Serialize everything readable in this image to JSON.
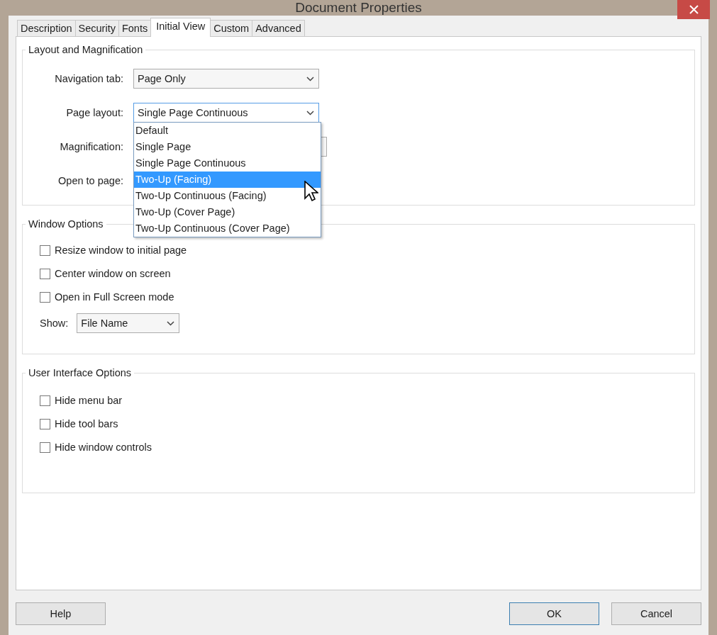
{
  "window": {
    "title": "Document Properties"
  },
  "tabs": [
    {
      "label": "Description",
      "selected": false
    },
    {
      "label": "Security",
      "selected": false
    },
    {
      "label": "Fonts",
      "selected": false
    },
    {
      "label": "Initial View",
      "selected": true
    },
    {
      "label": "Custom",
      "selected": false
    },
    {
      "label": "Advanced",
      "selected": false
    }
  ],
  "layout_and_magnification": {
    "title": "Layout and Magnification",
    "navigation_tab": {
      "label": "Navigation tab:",
      "value": "Page Only"
    },
    "page_layout": {
      "label": "Page layout:",
      "value": "Single Page Continuous",
      "expanded": true,
      "options": [
        {
          "label": "Default",
          "highlighted": false
        },
        {
          "label": "Single Page",
          "highlighted": false
        },
        {
          "label": "Single Page Continuous",
          "highlighted": false
        },
        {
          "label": "Two-Up (Facing)",
          "highlighted": true
        },
        {
          "label": "Two-Up Continuous (Facing)",
          "highlighted": false
        },
        {
          "label": "Two-Up (Cover Page)",
          "highlighted": false
        },
        {
          "label": "Two-Up Continuous (Cover Page)",
          "highlighted": false
        }
      ]
    },
    "magnification": {
      "label": "Magnification:"
    },
    "open_to_page": {
      "label": "Open to page:"
    }
  },
  "window_options": {
    "title": "Window Options",
    "checkboxes": [
      {
        "label": "Resize window to initial page",
        "checked": false
      },
      {
        "label": "Center window on screen",
        "checked": false
      },
      {
        "label": "Open in Full Screen mode",
        "checked": false
      }
    ],
    "show": {
      "label": "Show:",
      "value": "File Name"
    }
  },
  "user_interface_options": {
    "title": "User Interface Options",
    "checkboxes": [
      {
        "label": "Hide menu bar",
        "checked": false
      },
      {
        "label": "Hide tool bars",
        "checked": false
      },
      {
        "label": "Hide window controls",
        "checked": false
      }
    ]
  },
  "buttons": [
    {
      "label": "Help",
      "default": false
    },
    {
      "label": "OK",
      "default": true
    },
    {
      "label": "Cancel",
      "default": false
    }
  ]
}
